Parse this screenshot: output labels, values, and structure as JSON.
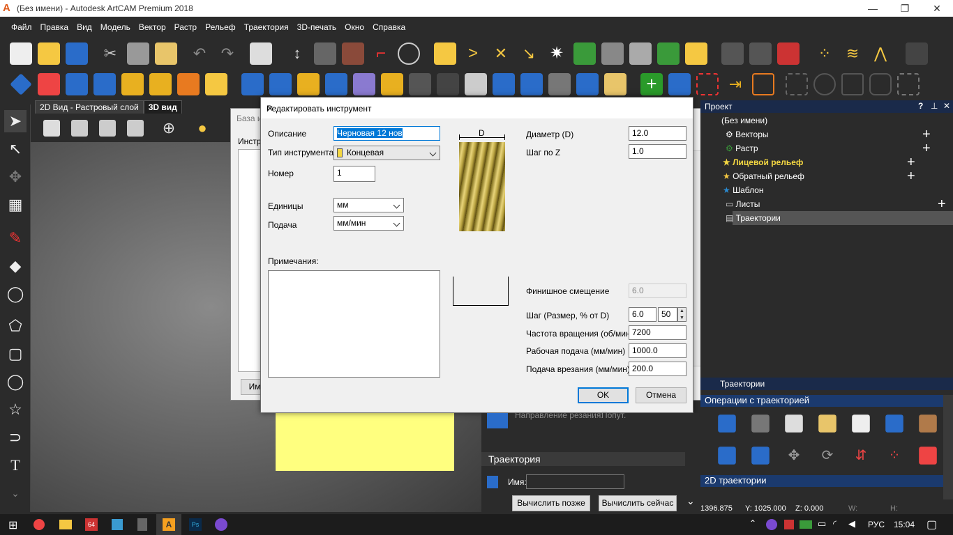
{
  "window": {
    "title": "(Без имени) - Autodesk ArtCAM Premium 2018"
  },
  "menu": [
    "Файл",
    "Правка",
    "Вид",
    "Модель",
    "Вектор",
    "Растр",
    "Рельеф",
    "Траектория",
    "3D-печать",
    "Окно",
    "Справка"
  ],
  "view_tabs": {
    "tab1": "2D Вид - Растровый слой",
    "tab2": "3D вид"
  },
  "bg_dialog": {
    "title": "База и",
    "label": "Инстр",
    "btn": "Им"
  },
  "dialog": {
    "title": "Редактировать инструмент",
    "description_label": "Описание",
    "description_value": "Черновая 12 нов",
    "type_label": "Тип инструмента",
    "type_value": "Концевая",
    "number_label": "Номер",
    "number_value": "1",
    "units_label": "Единицы",
    "units_value": "мм",
    "feed_label": "Подача",
    "feed_value": "мм/мин",
    "notes_label": "Примечания:",
    "d_label": "D",
    "diameter_label": "Диаметр (D)",
    "diameter_value": "12.0",
    "stepz_label": "Шаг по Z",
    "stepz_value": "1.0",
    "finish_label": "Финишное смещение",
    "finish_value": "6.0",
    "step_label": "Шаг (Размер, % от D)",
    "step_value": "6.0",
    "step_pct": "50",
    "spindle_label": "Частота вращения (об/мин)",
    "spindle_value": "7200",
    "workfeed_label": "Рабочая подача (мм/мин)",
    "workfeed_value": "1000.0",
    "plunge_label": "Подача врезания (мм/мин)",
    "plunge_value": "200.0",
    "ok": "OK",
    "cancel": "Отмена"
  },
  "project": {
    "header": "Проект",
    "root": "(Без имени)",
    "items": [
      "Векторы",
      "Растр",
      "Лицевой рельеф",
      "Обратный рельеф",
      "Шаблон",
      "Листы",
      "Траектории"
    ]
  },
  "toolpaths": {
    "header": "Траектории",
    "ops_header": "Операции с траекторией",
    "twod_header": "2D траектории"
  },
  "midpanel": {
    "cut_dir_label": "Направление резания:",
    "cut_dir_value": "Попут.",
    "section": "Траектория",
    "name_label": "Имя:",
    "calc_later": "Вычислить позже",
    "calc_now": "Вычислить сейчас"
  },
  "status": {
    "x": "1396.875",
    "y": "Y: 1025.000",
    "z": "Z: 0.000",
    "w": "W:",
    "h": "H:"
  },
  "taskbar": {
    "lang": "РУС",
    "time": "15:04"
  }
}
